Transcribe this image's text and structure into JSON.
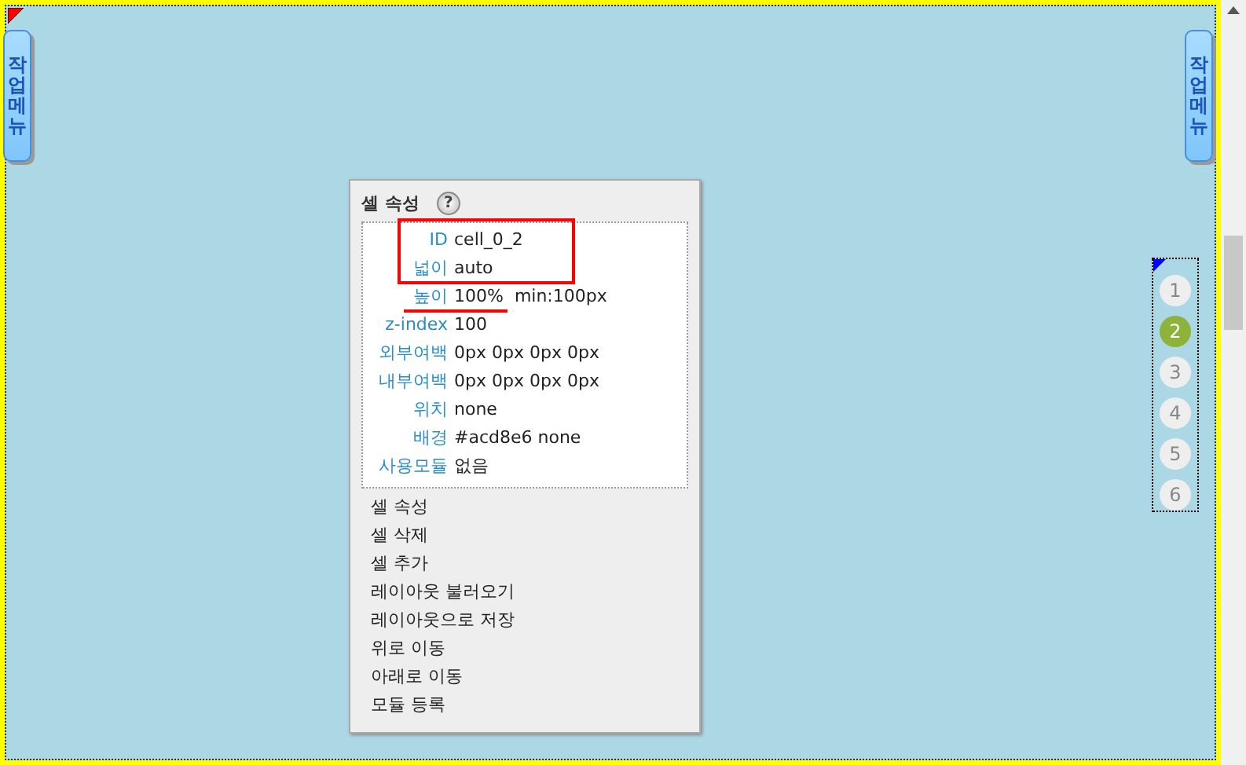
{
  "side_tabs": [
    {
      "label": "작업메뉴"
    },
    {
      "label": "작업메뉴"
    }
  ],
  "panel": {
    "title": "셀 속성",
    "help": "?",
    "properties": [
      {
        "label": "ID",
        "value": "cell_0_2"
      },
      {
        "label": "넓이",
        "value": "auto"
      },
      {
        "label": "높이",
        "value": "100%  min:100px"
      },
      {
        "label": "z-index",
        "value": "100"
      },
      {
        "label": "외부여백",
        "value": "0px 0px 0px 0px"
      },
      {
        "label": "내부여백",
        "value": "0px 0px 0px 0px"
      },
      {
        "label": "위치",
        "value": "none"
      },
      {
        "label": "배경",
        "value": "#acd8e6 none"
      },
      {
        "label": "사용모듈",
        "value": "없음"
      }
    ],
    "menu": [
      "셀 속성",
      "셀 삭제",
      "셀 추가",
      "레이아웃 불러오기",
      "레이아웃으로 저장",
      "위로 이동",
      "아래로 이동",
      "모듈 등록"
    ]
  },
  "pager": [
    {
      "label": "1",
      "selected": false
    },
    {
      "label": "2",
      "selected": true
    },
    {
      "label": "3",
      "selected": false
    },
    {
      "label": "4",
      "selected": false
    },
    {
      "label": "5",
      "selected": false
    },
    {
      "label": "6",
      "selected": false
    }
  ]
}
